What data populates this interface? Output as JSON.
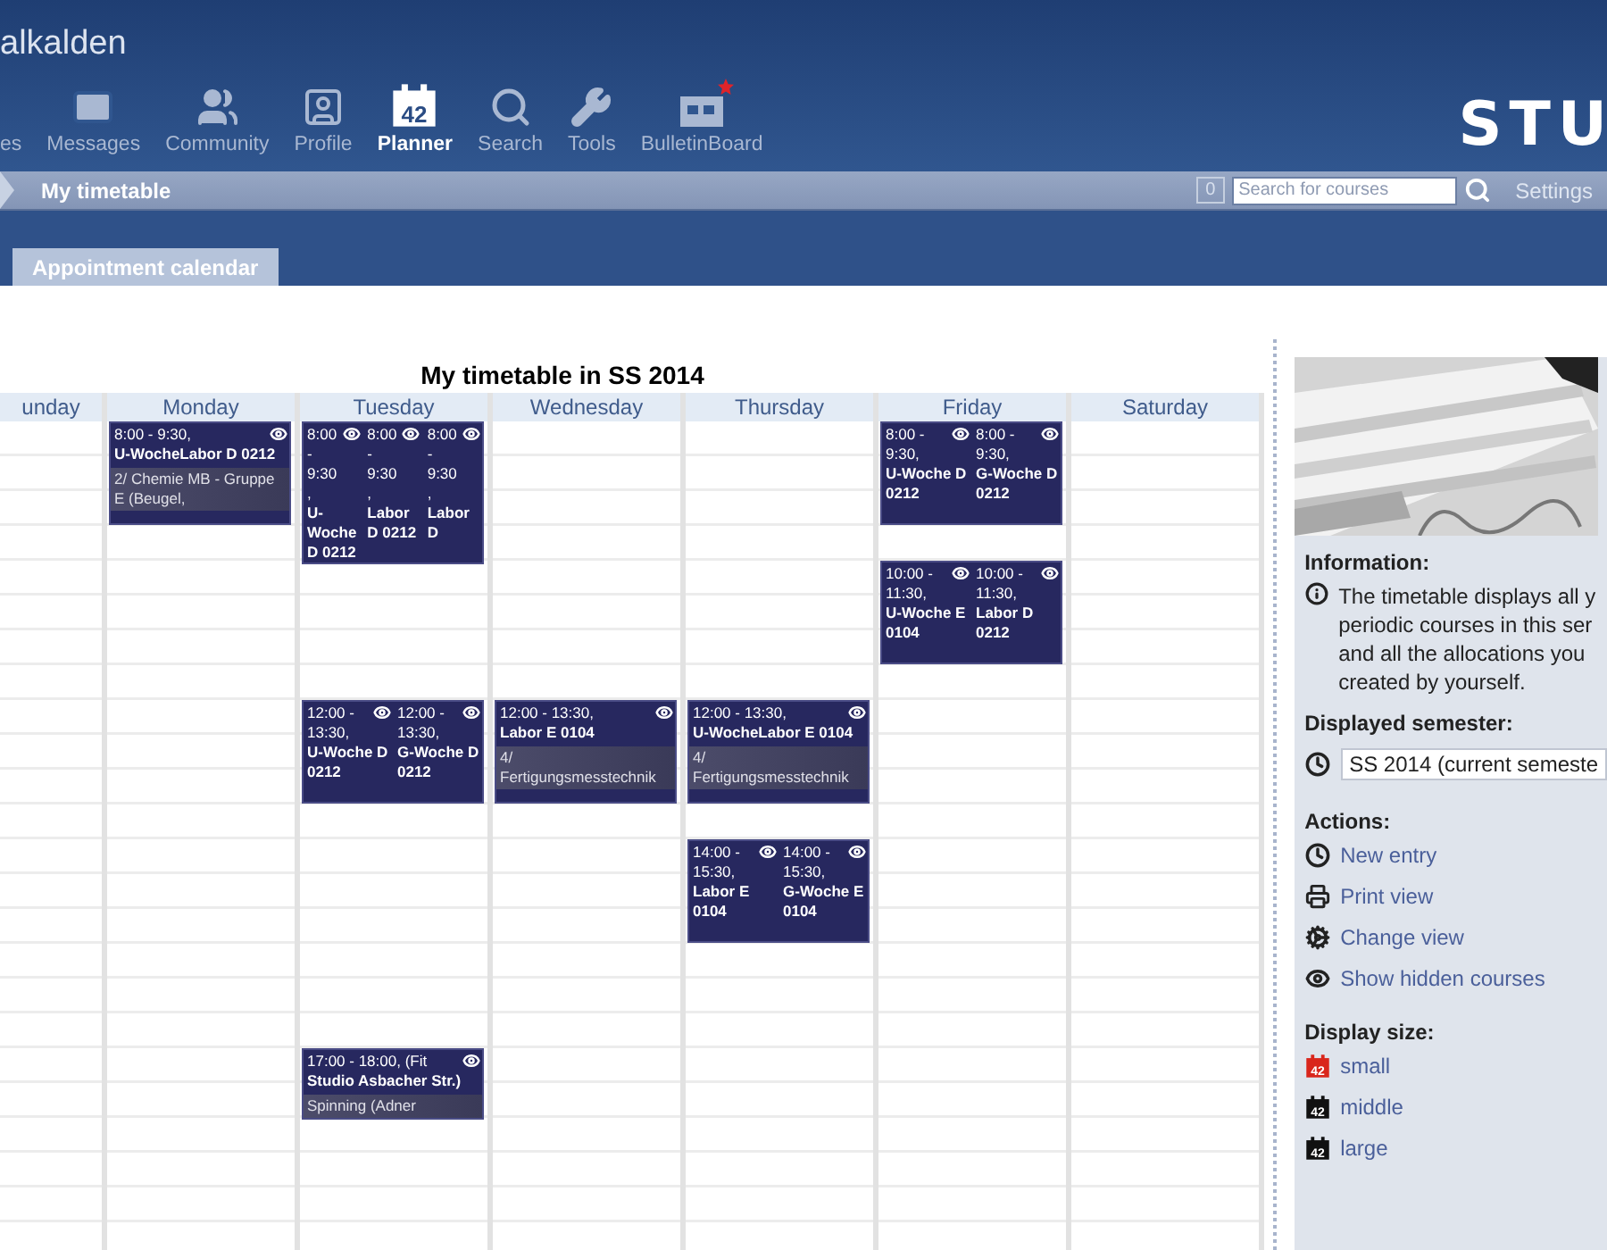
{
  "header": {
    "title": "alkalden",
    "logo": "STU",
    "nav": [
      {
        "label": "es",
        "selected": false
      },
      {
        "label": "Messages",
        "selected": false
      },
      {
        "label": "Community",
        "selected": false
      },
      {
        "label": "Profile",
        "selected": false
      },
      {
        "label": "Planner",
        "selected": true,
        "icon_label": "42"
      },
      {
        "label": "Search",
        "selected": false
      },
      {
        "label": "Tools",
        "selected": false
      },
      {
        "label": "BulletinBoard",
        "selected": false,
        "new": true
      }
    ]
  },
  "breadcrumb": {
    "current": "My timetable",
    "counter": "0",
    "search": {
      "placeholder": "Search for courses"
    },
    "settings": "Settings"
  },
  "tabs": [
    {
      "label": "Appointment calendar",
      "selected": false
    }
  ],
  "timetable": {
    "title": "My timetable in SS 2014",
    "days": [
      {
        "name": "unday"
      },
      {
        "name": "Monday",
        "blocks": [
          {
            "entries": [
              {
                "time": "8:00 - 9:30,",
                "title": "U-WocheLabor D 0212",
                "note": "2/ Chemie MB - Gruppe E (Beugel,"
              }
            ]
          }
        ]
      },
      {
        "name": "Tuesday",
        "blocks": [
          {
            "entries": [
              {
                "time": "8:00 - 9:30,",
                "title": "U-Woche D 0212"
              },
              {
                "time": "8:00 - 9:30,",
                "title": "Labor D 0212"
              },
              {
                "time": "8:00 - 9:30,",
                "title": "Labor D"
              }
            ]
          },
          {
            "entries": [
              {
                "time": "12:00 - 13:30,",
                "title": "U-Woche D 0212"
              },
              {
                "time": "12:00 - 13:30,",
                "title": "G-Woche D 0212"
              }
            ]
          },
          {
            "entries": [
              {
                "time": "17:00 - 18:00, (Fit",
                "title": "Studio Asbacher Str.)",
                "note": "Spinning (Adner"
              }
            ]
          }
        ]
      },
      {
        "name": "Wednesday",
        "blocks": [
          {
            "entries": [
              {
                "time": "12:00 - 13:30,",
                "title": "Labor E 0104",
                "note": "4/ Fertigungsmesstechnik"
              }
            ]
          }
        ]
      },
      {
        "name": "Thursday",
        "blocks": [
          {
            "entries": [
              {
                "time": "12:00 - 13:30,",
                "title": "U-WocheLabor E 0104",
                "note": "4/ Fertigungsmesstechnik"
              }
            ]
          },
          {
            "entries": [
              {
                "time": "14:00 - 15:30,",
                "title": "Labor E 0104"
              },
              {
                "time": "14:00 - 15:30,",
                "title": "G-Woche E 0104"
              }
            ]
          }
        ]
      },
      {
        "name": "Friday",
        "blocks": [
          {
            "entries": [
              {
                "time": "8:00 - 9:30,",
                "title": "U-Woche D 0212"
              },
              {
                "time": "8:00 - 9:30,",
                "title": "G-Woche D 0212"
              }
            ]
          },
          {
            "entries": [
              {
                "time": "10:00 - 11:30,",
                "title": "U-Woche E 0104"
              },
              {
                "time": "10:00 - 11:30,",
                "title": "Labor D 0212"
              }
            ]
          }
        ]
      },
      {
        "name": "Saturday"
      }
    ]
  },
  "sidebar": {
    "information": {
      "heading": "Information:",
      "lines": [
        "The timetable displays all y",
        "periodic courses in this ser",
        "and all the allocations you",
        "created by yourself."
      ]
    },
    "semester": {
      "heading": "Displayed semester:",
      "value": "SS 2014 (current semeste"
    },
    "actions": {
      "heading": "Actions:",
      "items": [
        "New entry",
        "Print view",
        "Change view",
        "Show hidden courses"
      ]
    },
    "display_size": {
      "heading": "Display size:",
      "options": [
        {
          "label": "small",
          "selected": true,
          "icon_label": "42"
        },
        {
          "label": "middle",
          "selected": false,
          "icon_label": "42"
        },
        {
          "label": "large",
          "selected": false,
          "icon_label": "42"
        }
      ]
    }
  }
}
